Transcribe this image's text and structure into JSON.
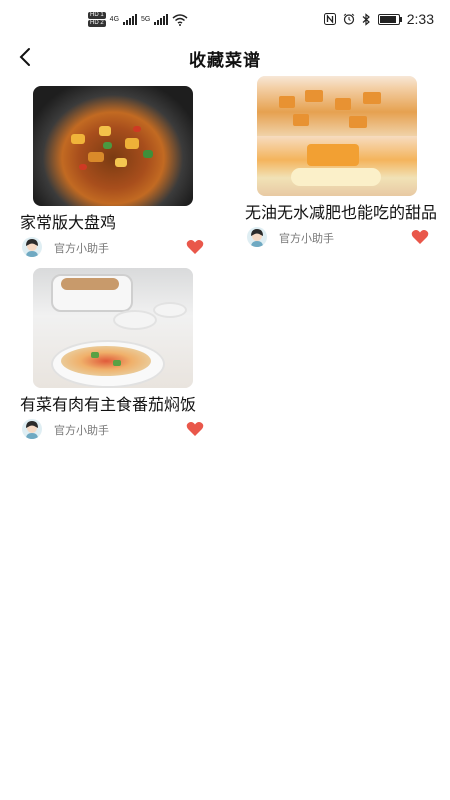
{
  "status_bar": {
    "hd1": "HD 1",
    "hd2": "HD 2",
    "net1": "4G",
    "net2": "5G",
    "battery_level": 0.9,
    "time": "2:33"
  },
  "header": {
    "title": "收藏菜谱"
  },
  "recipes": [
    {
      "name": "家常版大盘鸡",
      "author": "官方小助手",
      "favorited": true
    },
    {
      "name": "无油无水减肥也能吃的甜品",
      "author": "官方小助手",
      "favorited": true
    },
    {
      "name": "有菜有肉有主食番茄焖饭",
      "author": "官方小助手",
      "favorited": true
    }
  ],
  "colors": {
    "heart": "#e9574a",
    "title_text": "#111111",
    "author_text": "#777777"
  },
  "icons": {
    "back": "chevron-left-icon",
    "favorite": "heart-icon",
    "avatar": "avatar-icon"
  }
}
